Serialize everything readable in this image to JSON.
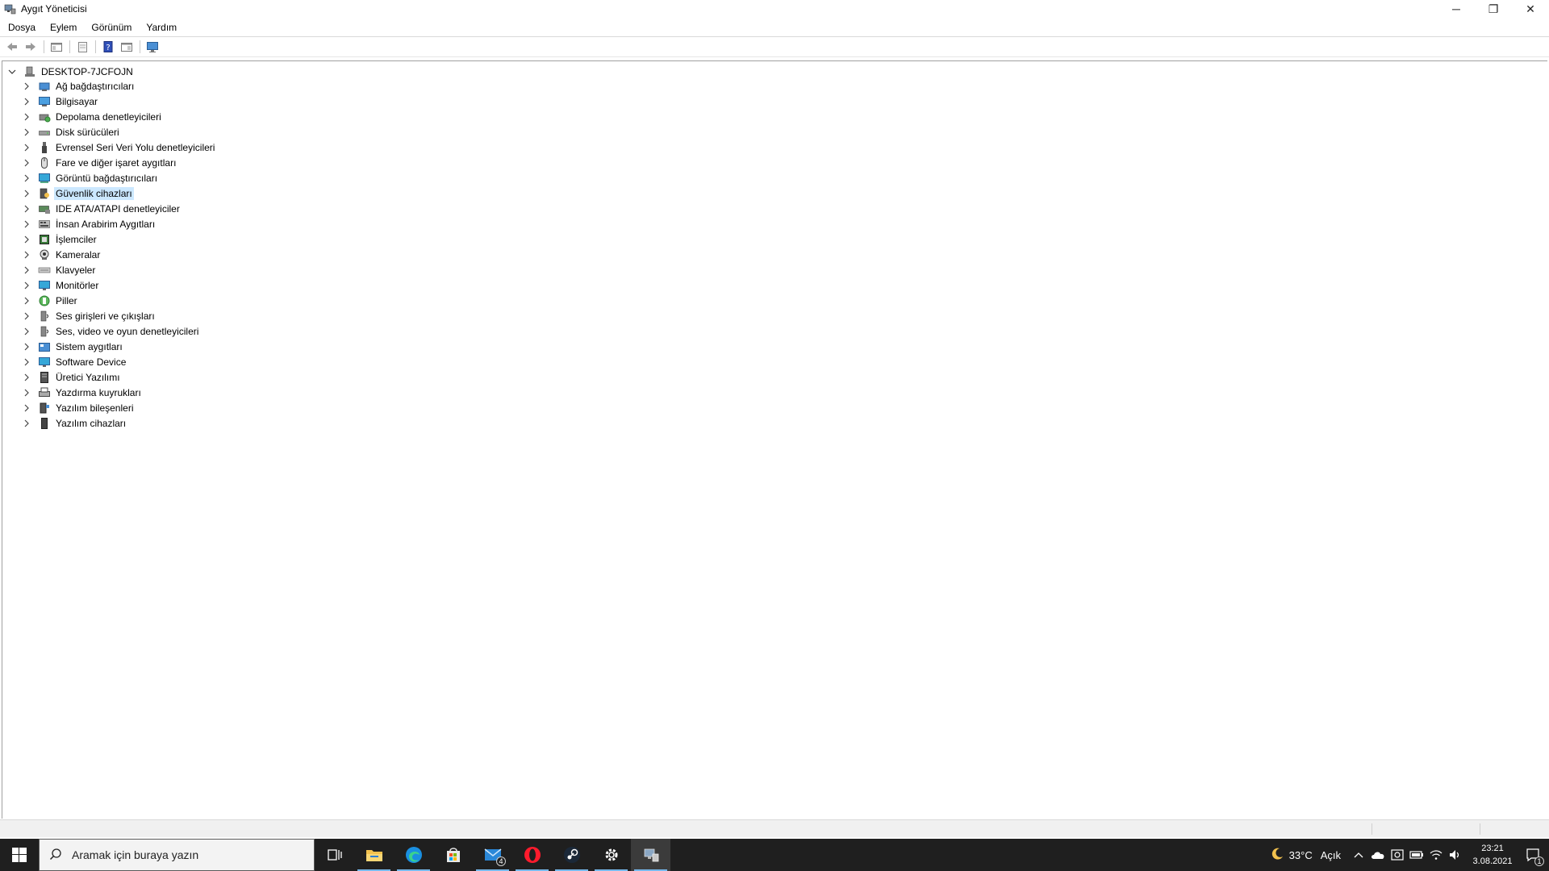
{
  "window": {
    "title": "Aygıt Yöneticisi",
    "controls": {
      "minimize": "─",
      "maximize": "❐",
      "close": "✕"
    }
  },
  "menu": [
    "Dosya",
    "Eylem",
    "Görünüm",
    "Yardım"
  ],
  "toolbar": [
    "back-icon",
    "forward-icon",
    "show-hide-tree-icon",
    "properties-icon",
    "help-icon",
    "action-pane-icon",
    "monitor-scan-icon"
  ],
  "tree": {
    "root": "DESKTOP-7JCFOJN",
    "items": [
      {
        "label": "Ağ bağdaştırıcıları",
        "icon": "network-adapter-icon"
      },
      {
        "label": "Bilgisayar",
        "icon": "computer-icon"
      },
      {
        "label": "Depolama denetleyicileri",
        "icon": "storage-controller-icon"
      },
      {
        "label": "Disk sürücüleri",
        "icon": "disk-drive-icon"
      },
      {
        "label": "Evrensel Seri Veri Yolu denetleyicileri",
        "icon": "usb-icon"
      },
      {
        "label": "Fare ve diğer işaret aygıtları",
        "icon": "mouse-icon"
      },
      {
        "label": "Görüntü bağdaştırıcıları",
        "icon": "display-adapter-icon"
      },
      {
        "label": "Güvenlik cihazları",
        "icon": "security-device-icon",
        "selected": true
      },
      {
        "label": "IDE ATA/ATAPI denetleyiciler",
        "icon": "ide-controller-icon"
      },
      {
        "label": "İnsan Arabirim Aygıtları",
        "icon": "hid-icon"
      },
      {
        "label": "İşlemciler",
        "icon": "processor-icon"
      },
      {
        "label": "Kameralar",
        "icon": "camera-icon"
      },
      {
        "label": "Klavyeler",
        "icon": "keyboard-icon"
      },
      {
        "label": "Monitörler",
        "icon": "monitor-icon"
      },
      {
        "label": "Piller",
        "icon": "battery-icon"
      },
      {
        "label": "Ses girişleri ve çıkışları",
        "icon": "audio-io-icon"
      },
      {
        "label": "Ses, video ve oyun denetleyicileri",
        "icon": "sound-controller-icon"
      },
      {
        "label": "Sistem aygıtları",
        "icon": "system-device-icon"
      },
      {
        "label": "Software Device",
        "icon": "software-device-icon"
      },
      {
        "label": "Üretici Yazılımı",
        "icon": "firmware-icon"
      },
      {
        "label": "Yazdırma kuyrukları",
        "icon": "print-queue-icon"
      },
      {
        "label": "Yazılım bileşenleri",
        "icon": "software-component-icon"
      },
      {
        "label": "Yazılım cihazları",
        "icon": "software-device-2-icon"
      }
    ]
  },
  "taskbar": {
    "search_placeholder": "Aramak için buraya yazın",
    "apps": [
      "task-view-icon",
      "file-explorer-icon",
      "edge-icon",
      "store-icon",
      "mail-icon",
      "opera-icon",
      "steam-icon",
      "settings-icon",
      "device-manager-icon"
    ],
    "mail_badge": "4",
    "weather_temp": "33°C",
    "weather_text": "Açık",
    "time": "23:21",
    "date": "3.08.2021",
    "notification_count": "1"
  },
  "colors": {
    "taskbar_bg": "#1f1f1f",
    "selection_bg": "#cce8ff",
    "accent": "#0078d7"
  }
}
